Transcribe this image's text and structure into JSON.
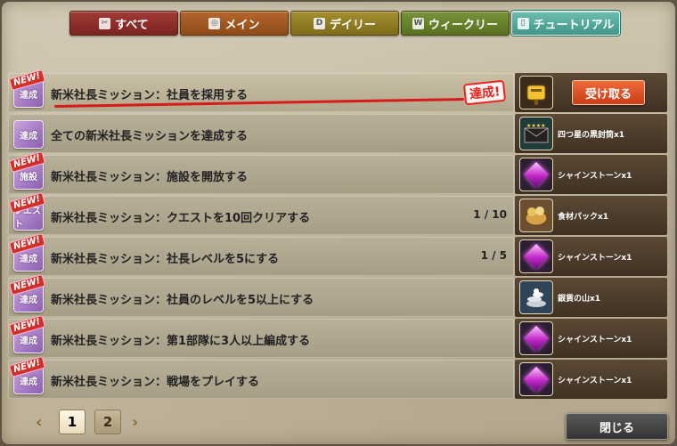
{
  "tabs": [
    {
      "label": "すべて",
      "icon": "pin-icon"
    },
    {
      "label": "メイン",
      "icon": "ring-icon"
    },
    {
      "label": "デイリー",
      "icon": "d-letter-icon"
    },
    {
      "label": "ウィークリー",
      "icon": "w-letter-icon"
    },
    {
      "label": "チュートリアル",
      "icon": "book-icon"
    }
  ],
  "missions": [
    {
      "new": "NEW!",
      "badge": "達成",
      "title": "新米社長ミッション：社員を採用する",
      "progress": "",
      "reward": "",
      "claim_label": "受け取る",
      "stamp": "達成!"
    },
    {
      "new": "",
      "badge": "達成",
      "title": "全ての新米社長ミッションを達成する",
      "progress": "",
      "reward": "四つ星の黒封筒x1"
    },
    {
      "new": "NEW!",
      "badge": "施設",
      "title": "新米社長ミッション：施設を開放する",
      "progress": "",
      "reward": "シャインストーンx1"
    },
    {
      "new": "NEW!",
      "badge": "クエスト",
      "title": "新米社長ミッション：クエストを10回クリアする",
      "progress": "1 / 10",
      "reward": "食材パックx1"
    },
    {
      "new": "NEW!",
      "badge": "達成",
      "title": "新米社長ミッション：社長レベルを5にする",
      "progress": "1 / 5",
      "reward": "シャインストーンx1"
    },
    {
      "new": "NEW!",
      "badge": "達成",
      "title": "新米社長ミッション：社員のレベルを5以上にする",
      "progress": "",
      "reward": "銀貨の山x1"
    },
    {
      "new": "NEW!",
      "badge": "達成",
      "title": "新米社長ミッション：第1部隊に3人以上編成する",
      "progress": "",
      "reward": "シャインストーンx1"
    },
    {
      "new": "NEW!",
      "badge": "達成",
      "title": "新米社長ミッション：戦場をプレイする",
      "progress": "",
      "reward": "シャインストーンx1"
    }
  ],
  "pagination": {
    "prev": "‹",
    "pages": [
      "1",
      "2"
    ],
    "next": "›",
    "current": 1
  },
  "close_label": "閉じる",
  "colors": {
    "tab_all": "#a13a36",
    "tab_main": "#b4672b",
    "tab_daily": "#a58f30",
    "tab_weekly": "#78943a",
    "tab_tutorial": "#6fbeb0",
    "claim": "#ef6b3a",
    "stamp": "#e22222"
  }
}
